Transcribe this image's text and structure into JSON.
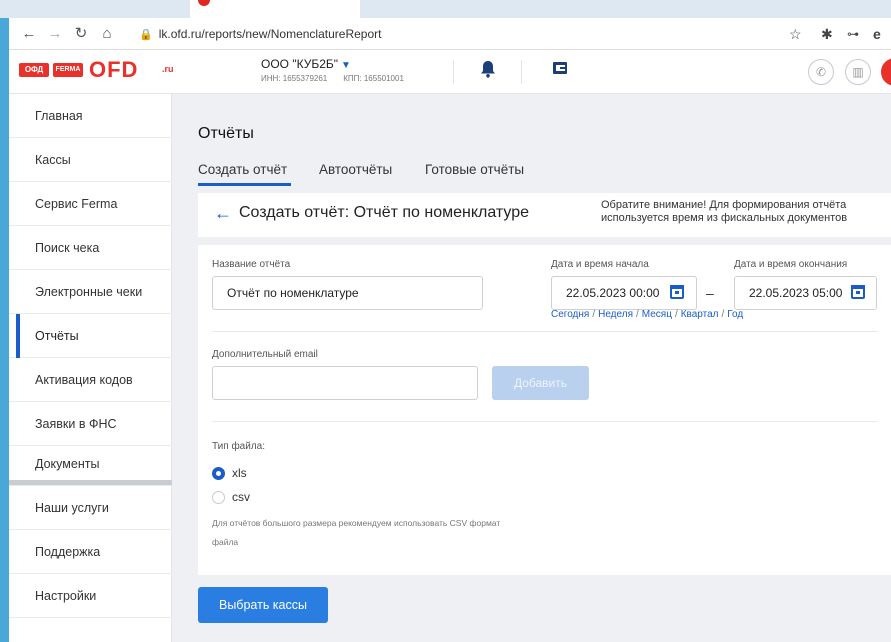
{
  "browser": {
    "url": "lk.ofd.ru/reports/new/NomenclatureReport",
    "nav_icons": [
      "arrow-left-icon",
      "arrow-right-icon",
      "reload-icon",
      "home-icon"
    ],
    "right_icons": [
      "star-icon",
      "extensions-icon",
      "key-icon",
      "profile-icon"
    ]
  },
  "header": {
    "logo_badge_1": "ОФД",
    "logo_badge_2": "FERMA",
    "logo_text": "OFD",
    "logo_suffix": ".ru",
    "org_name": "ООО \"КУБ2Б\"",
    "inn": "ИНН: 1655379261",
    "kpp": "КПП: 165501001",
    "brand_color": "#e8312b",
    "accent_color": "#1a5dc7"
  },
  "sidebar": {
    "items": [
      {
        "label": "Главная"
      },
      {
        "label": "Кассы"
      },
      {
        "label": "Сервис Ferma"
      },
      {
        "label": "Поиск чека"
      },
      {
        "label": "Электронные чеки"
      },
      {
        "label": "Отчёты",
        "active": true
      },
      {
        "label": "Активация кодов"
      },
      {
        "label": "Заявки в ФНС"
      },
      {
        "label": "Документы"
      },
      {
        "label": "Наши услуги"
      },
      {
        "label": "Поддержка"
      },
      {
        "label": "Настройки"
      }
    ]
  },
  "main": {
    "page_title": "Отчёты",
    "tabs": [
      {
        "label": "Создать отчёт",
        "active": true
      },
      {
        "label": "Автоотчёты"
      },
      {
        "label": "Готовые отчёты"
      }
    ],
    "card_title": "Создать отчёт: Отчёт по номенклатуре",
    "notice_line1": "Обратите внимание! Для формирования отчёта",
    "notice_line2": "используется время из фискальных документов",
    "report_name_label": "Название отчёта",
    "report_name_value": "Отчёт по номенклатуре",
    "start_label": "Дата и время начала",
    "start_value": "22.05.2023 00:00",
    "end_label": "Дата и время окончания",
    "end_value": "22.05.2023 05:00",
    "dash": "–",
    "quick_ranges": [
      "Сегодня",
      "Неделя",
      "Месяц",
      "Квартал",
      "Год"
    ],
    "email_label": "Дополнительный email",
    "email_value": "",
    "add_button": "Добавить",
    "file_type_label": "Тип файла:",
    "file_types": [
      {
        "label": "xls",
        "selected": true
      },
      {
        "label": "csv",
        "selected": false
      }
    ],
    "hint_line1": "Для отчётов большого размера рекомендуем использовать CSV формат",
    "hint_line2": "файла",
    "select_cashboxes_button": "Выбрать кассы"
  }
}
